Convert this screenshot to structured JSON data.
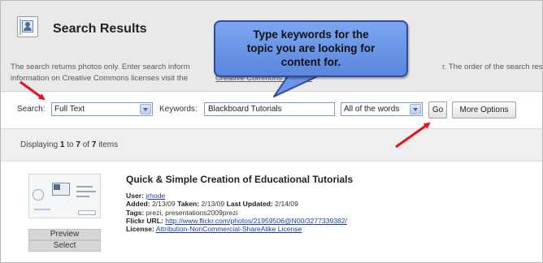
{
  "header": {
    "title": "Search Results",
    "info_line_1": "The search returns photos only. Enter search inform",
    "info_line_1_tail": "r. The order of the search results a",
    "info_line_2": "information on Creative Commons licenses visit the",
    "cc_link_label": "Creative Commons Website"
  },
  "callout": {
    "line_1": "Type keywords for the",
    "line_2": "topic you are looking for",
    "line_3": "content for."
  },
  "search": {
    "search_label": "Search:",
    "search_field_value": "Full Text",
    "keywords_label": "Keywords:",
    "keywords_value": "Blackboard Tutorials",
    "match_value": "All of the words",
    "go_label": "Go",
    "more_options_label": "More Options"
  },
  "results": {
    "displaying_prefix": "Displaying ",
    "from": "1",
    "to_word": " to ",
    "to": "7",
    "of_word": " of ",
    "total": "7",
    "items_word": " items"
  },
  "result_item": {
    "title": "Quick & Simple Creation of Educational Tutorials",
    "user_label": "User:",
    "user_value": "jrhode",
    "added_label": "Added:",
    "added_value": "2/13/09",
    "taken_label": "Taken:",
    "taken_value": "2/13/09",
    "updated_label": "Last Updated:",
    "updated_value": "2/14/09",
    "tags_label": "Tags:",
    "tags_value": "prezi, presentations2009prezi",
    "flickr_label": "Flickr URL:",
    "flickr_value": "http://www.flickr.com/photos/21959506@N00/3277339382/",
    "license_label": "License:",
    "license_value": "Attribution-NonCommercial-ShareAlike License",
    "preview_label": "Preview",
    "select_label": "Select"
  },
  "colors": {
    "callout_fill": "#6b96e8",
    "callout_border": "#2e4c9a",
    "arrow_red": "#e8101e",
    "link_blue": "#1c3f9e"
  }
}
